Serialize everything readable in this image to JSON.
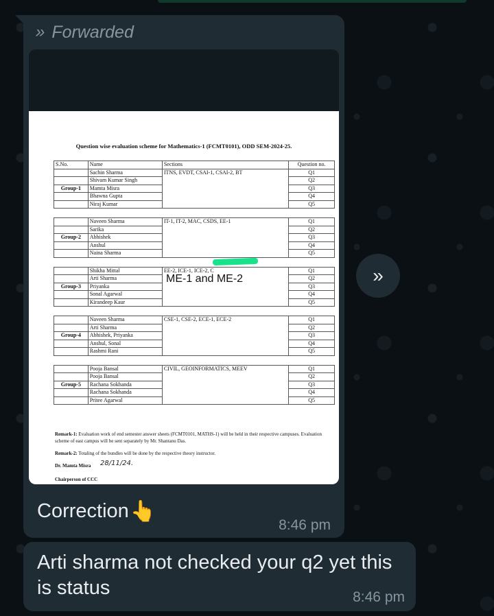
{
  "messages": {
    "forwarded": {
      "label": "Forwarded",
      "caption": "Correction",
      "time": "8:46 pm",
      "document": {
        "title": "Question wise evaluation scheme for Mathematics-1 (FCMT0101), ODD SEM-2024-25.",
        "headers": [
          "S.No.",
          "Name",
          "Sections",
          "Question no."
        ],
        "groups": [
          {
            "label": "Group-1",
            "names": [
              "Sachin Sharma",
              "Shivam Kumar Singh",
              "Mamta Misra",
              "Bhawna Gupta",
              "Niraj Kumar"
            ],
            "sections": "ITNS, EVDT, CSAI-1, CSAI-2, BT",
            "questions": [
              "Q1",
              "Q2",
              "Q3",
              "Q4",
              "Q5"
            ]
          },
          {
            "label": "Group-2",
            "names": [
              "Naveen Sharma",
              "Sarika",
              "Abhishek",
              "Anshul",
              "Naina Sharma"
            ],
            "sections": "IT-1, IT-2, MAC, CSDS, EE-1",
            "questions": [
              "Q1",
              "Q2",
              "Q3",
              "Q4",
              "Q5"
            ]
          },
          {
            "label": "Group-3",
            "names": [
              "Shikha Mittal",
              "Arti Sharma",
              "Priyanka",
              "Sonal Agarwal",
              "Kirandeep Kaur"
            ],
            "sections": "EE-2, ICE-1, ICE-2, C",
            "questions": [
              "Q1",
              "Q2",
              "Q3",
              "Q4",
              "Q5"
            ]
          },
          {
            "label": "Group-4",
            "names": [
              "Naveen Sharma",
              "Arti Sharma",
              "Abhishek, Priyanka",
              "Anshul, Sonal",
              "Rashmi Rani"
            ],
            "sections": "CSE-1, CSE-2, ECE-1, ECE-2",
            "questions": [
              "Q1",
              "Q2",
              "Q3",
              "Q4",
              "Q5"
            ]
          },
          {
            "label": "Group-5",
            "names": [
              "Pooja Bansal",
              "Pooja Bansal",
              "Rachana Sokhanda",
              "Rachana Sokhanda",
              "Pritee Agarwal"
            ],
            "sections": "CIVIL, GEOINFORMATICS, MEEV",
            "questions": [
              "Q1",
              "Q2",
              "Q3",
              "Q4",
              "Q5"
            ]
          }
        ],
        "annotation": "ME-1 and ME-2",
        "remark1_label": "Remark-1:",
        "remark1": "Evaluation work of end semester answer sheets (FCMT0101, MATHS-1) will be held in their respective campuses. Evaluation scheme of east campus will be sent separately by Mr. Shantanu Das.",
        "remark2_label": "Remark-2:",
        "remark2": "Totaling of the bundles will be done by the respective theory instructor.",
        "signatory": "Dr. Mamta Misra",
        "signature_note": "28/11/24.",
        "footer": "Chairperson of CCC"
      }
    },
    "reply": {
      "text": "Arti sharma not checked your q2 yet this is status",
      "time": "8:46 pm"
    }
  },
  "icons": {
    "forward": "forward-icon",
    "point": "pointing-hand-icon",
    "share": "share-forward-icon"
  },
  "colors": {
    "bubble": "#1f2c33",
    "background": "#0b1014",
    "meta": "#8696a0",
    "highlight": "#19e38a"
  }
}
